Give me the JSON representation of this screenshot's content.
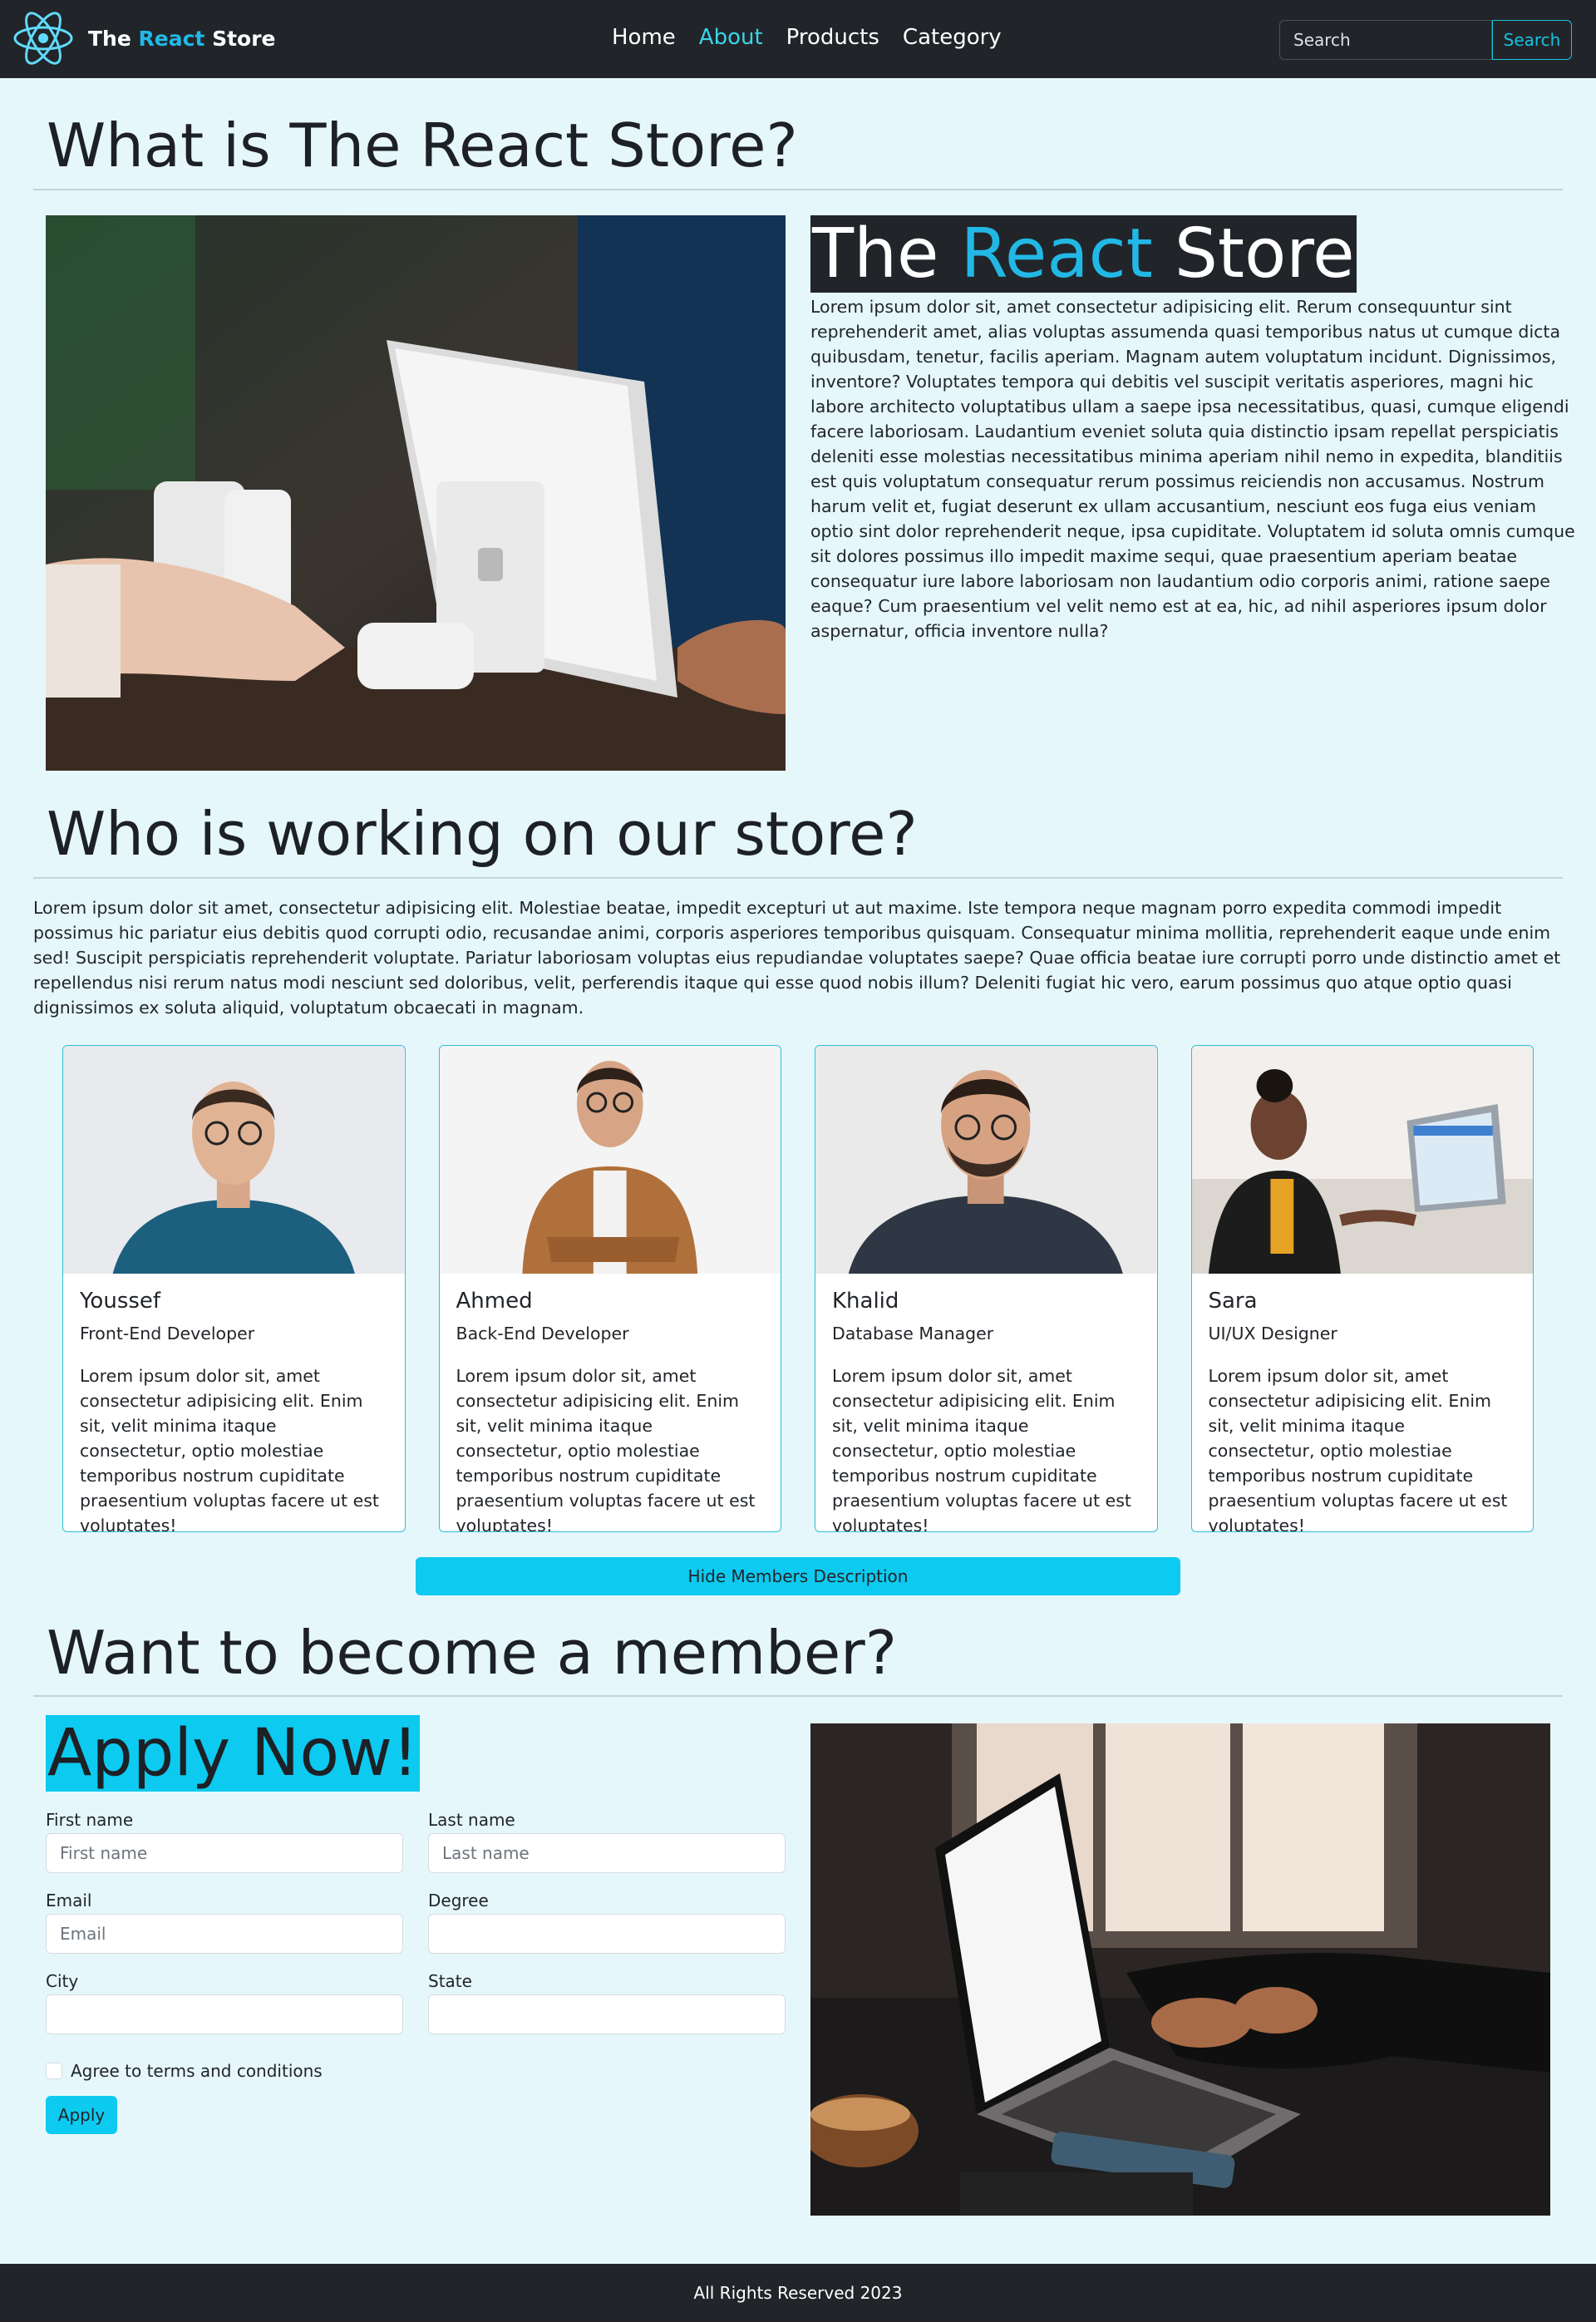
{
  "brand": {
    "prefix": "The ",
    "accent": "React",
    "suffix": " Store"
  },
  "nav": {
    "links": [
      {
        "label": "Home"
      },
      {
        "label": "About"
      },
      {
        "label": "Products"
      },
      {
        "label": "Category"
      }
    ],
    "search_placeholder": "Search",
    "search_button": "Search"
  },
  "about": {
    "heading": "What is The React Store?",
    "title_prefix": "The ",
    "title_accent": "React",
    "title_suffix": " Store",
    "text": "Lorem ipsum dolor sit, amet consectetur adipisicing elit. Rerum consequuntur sint reprehenderit amet, alias voluptas assumenda quasi temporibus natus ut cumque dicta quibusdam, tenetur, facilis aperiam. Magnam autem voluptatum incidunt. Dignissimos, inventore? Voluptates tempora qui debitis vel suscipit veritatis asperiores, magni hic labore architecto voluptatibus ullam a saepe ipsa necessitatibus, quasi, cumque eligendi facere laboriosam. Laudantium eveniet soluta quia distinctio ipsam repellat perspiciatis deleniti esse molestias necessitatibus minima aperiam nihil nemo in expedita, blanditiis est quis voluptatum consequatur rerum possimus reiciendis non accusamus. Nostrum harum velit et, fugiat deserunt ex ullam accusantium, nesciunt eos fuga eius veniam optio sint dolor reprehenderit neque, ipsa cupiditate. Voluptatem id soluta omnis cumque sit dolores possimus illo impedit maxime sequi, quae praesentium aperiam beatae consequatur iure labore laboriosam non laudantium odio corporis animi, ratione saepe eaque? Cum praesentium vel velit nemo est at ea, hic, ad nihil asperiores ipsum dolor aspernatur, officia inventore nulla?"
  },
  "team": {
    "heading": "Who is working on our store?",
    "intro": "Lorem ipsum dolor sit amet, consectetur adipisicing elit. Molestiae beatae, impedit excepturi ut aut maxime. Iste tempora neque magnam porro expedita commodi impedit possimus hic pariatur eius debitis quod corrupti odio, recusandae animi, corporis asperiores temporibus quisquam. Consequatur minima mollitia, reprehenderit eaque unde enim sed! Suscipit perspiciatis reprehenderit voluptate. Pariatur laboriosam voluptas eius repudiandae voluptates saepe? Quae officia beatae iure corrupti porro unde distinctio amet et repellendus nisi rerum natus modi nesciunt sed doloribus, velit, perferendis itaque qui esse quod nobis illum? Deleniti fugiat hic vero, earum possimus quo atque optio quasi dignissimos ex soluta aliquid, voluptatum obcaecati in magnam.",
    "members": [
      {
        "name": "Youssef",
        "role": "Front-End Developer",
        "desc": "Lorem ipsum dolor sit, amet consectetur adipisicing elit. Enim sit, velit minima itaque consectetur, optio molestiae temporibus nostrum cupiditate praesentium voluptas facere ut est voluptates!"
      },
      {
        "name": "Ahmed",
        "role": "Back-End Developer",
        "desc": "Lorem ipsum dolor sit, amet consectetur adipisicing elit. Enim sit, velit minima itaque consectetur, optio molestiae temporibus nostrum cupiditate praesentium voluptas facere ut est voluptates!"
      },
      {
        "name": "Khalid",
        "role": "Database Manager",
        "desc": "Lorem ipsum dolor sit, amet consectetur adipisicing elit. Enim sit, velit minima itaque consectetur, optio molestiae temporibus nostrum cupiditate praesentium voluptas facere ut est voluptates!"
      },
      {
        "name": "Sara",
        "role": "UI/UX Designer",
        "desc": "Lorem ipsum dolor sit, amet consectetur adipisicing elit. Enim sit, velit minima itaque consectetur, optio molestiae temporibus nostrum cupiditate praesentium voluptas facere ut est voluptates!"
      }
    ],
    "toggle_button": "Hide Members Description"
  },
  "member": {
    "heading": "Want to become a member?",
    "apply_title": "Apply Now!",
    "fields": {
      "first_name": {
        "label": "First name",
        "placeholder": "First name",
        "value": ""
      },
      "last_name": {
        "label": "Last name",
        "placeholder": "Last name",
        "value": ""
      },
      "email": {
        "label": "Email",
        "placeholder": "Email",
        "value": ""
      },
      "degree": {
        "label": "Degree",
        "placeholder": "",
        "value": ""
      },
      "city": {
        "label": "City",
        "placeholder": "",
        "value": ""
      },
      "state": {
        "label": "State",
        "placeholder": "",
        "value": ""
      }
    },
    "terms_label": "Agree to terms and conditions",
    "terms_checked": false,
    "apply_button": "Apply"
  },
  "footer": {
    "text": "All Rights Reserved 2023"
  },
  "colors": {
    "accent": "#22b8e6",
    "active_link": "#3cd3e8",
    "button": "#0dcaf0",
    "navbar": "#212529",
    "page_bg": "#e6f7fb"
  }
}
